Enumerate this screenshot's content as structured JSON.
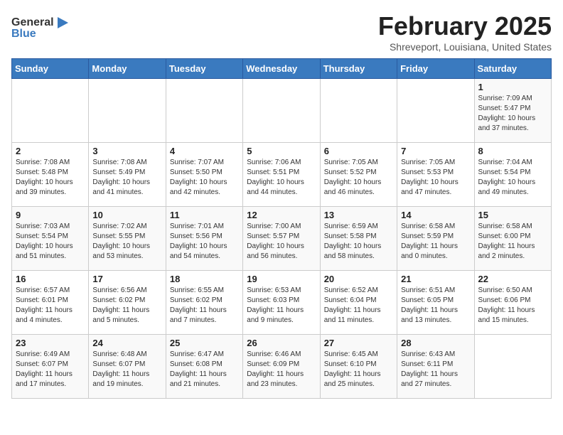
{
  "header": {
    "logo_line1": "General",
    "logo_line2": "Blue",
    "month": "February 2025",
    "location": "Shreveport, Louisiana, United States"
  },
  "days_of_week": [
    "Sunday",
    "Monday",
    "Tuesday",
    "Wednesday",
    "Thursday",
    "Friday",
    "Saturday"
  ],
  "weeks": [
    [
      {
        "day": "",
        "info": ""
      },
      {
        "day": "",
        "info": ""
      },
      {
        "day": "",
        "info": ""
      },
      {
        "day": "",
        "info": ""
      },
      {
        "day": "",
        "info": ""
      },
      {
        "day": "",
        "info": ""
      },
      {
        "day": "1",
        "info": "Sunrise: 7:09 AM\nSunset: 5:47 PM\nDaylight: 10 hours and 37 minutes."
      }
    ],
    [
      {
        "day": "2",
        "info": "Sunrise: 7:08 AM\nSunset: 5:48 PM\nDaylight: 10 hours and 39 minutes."
      },
      {
        "day": "3",
        "info": "Sunrise: 7:08 AM\nSunset: 5:49 PM\nDaylight: 10 hours and 41 minutes."
      },
      {
        "day": "4",
        "info": "Sunrise: 7:07 AM\nSunset: 5:50 PM\nDaylight: 10 hours and 42 minutes."
      },
      {
        "day": "5",
        "info": "Sunrise: 7:06 AM\nSunset: 5:51 PM\nDaylight: 10 hours and 44 minutes."
      },
      {
        "day": "6",
        "info": "Sunrise: 7:05 AM\nSunset: 5:52 PM\nDaylight: 10 hours and 46 minutes."
      },
      {
        "day": "7",
        "info": "Sunrise: 7:05 AM\nSunset: 5:53 PM\nDaylight: 10 hours and 47 minutes."
      },
      {
        "day": "8",
        "info": "Sunrise: 7:04 AM\nSunset: 5:54 PM\nDaylight: 10 hours and 49 minutes."
      }
    ],
    [
      {
        "day": "9",
        "info": "Sunrise: 7:03 AM\nSunset: 5:54 PM\nDaylight: 10 hours and 51 minutes."
      },
      {
        "day": "10",
        "info": "Sunrise: 7:02 AM\nSunset: 5:55 PM\nDaylight: 10 hours and 53 minutes."
      },
      {
        "day": "11",
        "info": "Sunrise: 7:01 AM\nSunset: 5:56 PM\nDaylight: 10 hours and 54 minutes."
      },
      {
        "day": "12",
        "info": "Sunrise: 7:00 AM\nSunset: 5:57 PM\nDaylight: 10 hours and 56 minutes."
      },
      {
        "day": "13",
        "info": "Sunrise: 6:59 AM\nSunset: 5:58 PM\nDaylight: 10 hours and 58 minutes."
      },
      {
        "day": "14",
        "info": "Sunrise: 6:58 AM\nSunset: 5:59 PM\nDaylight: 11 hours and 0 minutes."
      },
      {
        "day": "15",
        "info": "Sunrise: 6:58 AM\nSunset: 6:00 PM\nDaylight: 11 hours and 2 minutes."
      }
    ],
    [
      {
        "day": "16",
        "info": "Sunrise: 6:57 AM\nSunset: 6:01 PM\nDaylight: 11 hours and 4 minutes."
      },
      {
        "day": "17",
        "info": "Sunrise: 6:56 AM\nSunset: 6:02 PM\nDaylight: 11 hours and 5 minutes."
      },
      {
        "day": "18",
        "info": "Sunrise: 6:55 AM\nSunset: 6:02 PM\nDaylight: 11 hours and 7 minutes."
      },
      {
        "day": "19",
        "info": "Sunrise: 6:53 AM\nSunset: 6:03 PM\nDaylight: 11 hours and 9 minutes."
      },
      {
        "day": "20",
        "info": "Sunrise: 6:52 AM\nSunset: 6:04 PM\nDaylight: 11 hours and 11 minutes."
      },
      {
        "day": "21",
        "info": "Sunrise: 6:51 AM\nSunset: 6:05 PM\nDaylight: 11 hours and 13 minutes."
      },
      {
        "day": "22",
        "info": "Sunrise: 6:50 AM\nSunset: 6:06 PM\nDaylight: 11 hours and 15 minutes."
      }
    ],
    [
      {
        "day": "23",
        "info": "Sunrise: 6:49 AM\nSunset: 6:07 PM\nDaylight: 11 hours and 17 minutes."
      },
      {
        "day": "24",
        "info": "Sunrise: 6:48 AM\nSunset: 6:07 PM\nDaylight: 11 hours and 19 minutes."
      },
      {
        "day": "25",
        "info": "Sunrise: 6:47 AM\nSunset: 6:08 PM\nDaylight: 11 hours and 21 minutes."
      },
      {
        "day": "26",
        "info": "Sunrise: 6:46 AM\nSunset: 6:09 PM\nDaylight: 11 hours and 23 minutes."
      },
      {
        "day": "27",
        "info": "Sunrise: 6:45 AM\nSunset: 6:10 PM\nDaylight: 11 hours and 25 minutes."
      },
      {
        "day": "28",
        "info": "Sunrise: 6:43 AM\nSunset: 6:11 PM\nDaylight: 11 hours and 27 minutes."
      },
      {
        "day": "",
        "info": ""
      }
    ]
  ]
}
